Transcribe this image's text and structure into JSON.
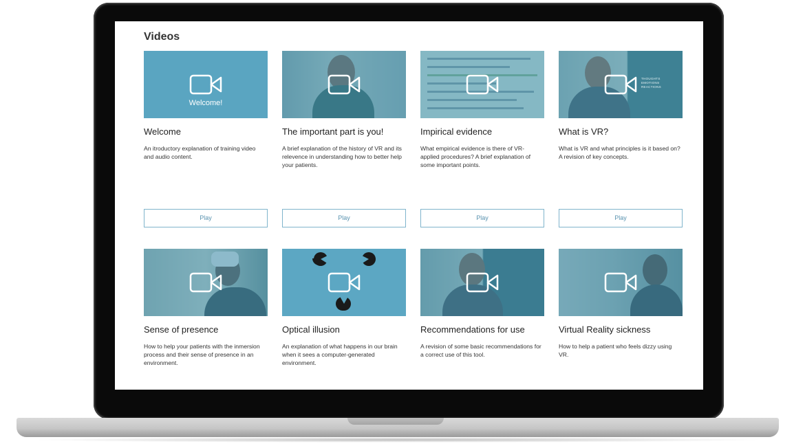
{
  "page": {
    "section_title": "Videos"
  },
  "videos": [
    {
      "title": "Welcome",
      "description": "An itroductory explanation of training video and audio content.",
      "thumbnail_caption": "Welcome!",
      "play_label": "Play"
    },
    {
      "title": "The important part is you!",
      "description": "A brief explanation of the history of VR and its relevence in understanding how to better help your patients.",
      "thumbnail_caption": "",
      "play_label": "Play"
    },
    {
      "title": "Impirical evidence",
      "description": "What empirical evidence is there of VR-applied procedures? A brief explanation of some important points.",
      "thumbnail_caption": "",
      "play_label": "Play"
    },
    {
      "title": "What is VR?",
      "description": "What is VR and what principles is it based on? A revision of key concepts.",
      "thumbnail_caption": "",
      "thumbnail_overlay_text": [
        "THOUGHTS",
        "EMOTIONS",
        "REACTIONS"
      ],
      "play_label": "Play"
    },
    {
      "title": "Sense of presence",
      "description": "How to help your patients with the inmersion process and their sense of presence in an environment.",
      "thumbnail_caption": ""
    },
    {
      "title": "Optical illusion",
      "description": "An explanation of what happens in our brain when it sees a computer-generated environment.",
      "thumbnail_caption": ""
    },
    {
      "title": "Recommendations for use",
      "description": "A revision of some basic recommendations for a correct use of this tool.",
      "thumbnail_caption": ""
    },
    {
      "title": "Virtual Reality sickness",
      "description": "How to help a patient who feels dizzy using VR.",
      "thumbnail_caption": ""
    }
  ],
  "icons": {
    "video": "video-camera-icon"
  },
  "colors": {
    "thumbnail_tint": "#4b9bbb",
    "play_border": "#7fb4cc",
    "play_text": "#5a93b0"
  }
}
